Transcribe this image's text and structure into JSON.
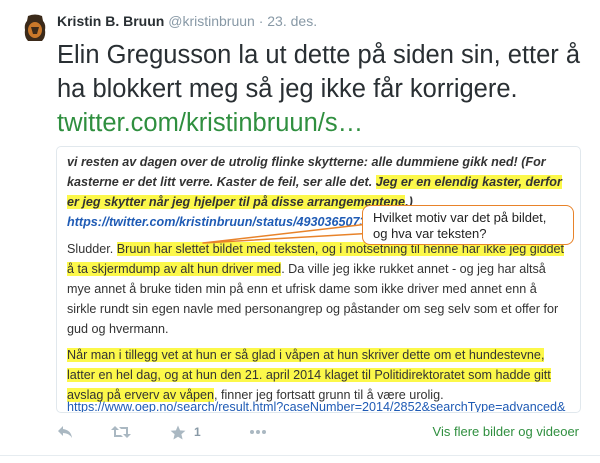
{
  "tweet": {
    "fullname": "Kristin B. Bruun",
    "username": "@kristinbruun",
    "separator": "·",
    "date": "23. des.",
    "text": "Elin Gregusson la ut dette på siden sin, etter å ha blokkert meg så jeg ikke får korrigere.",
    "link": "twitter.com/kristinbruun/s…"
  },
  "media": {
    "p1": {
      "a": "vi resten av dagen over de utrolig flinke skytterne: alle dummiene gikk ned! (For kasterne er det litt verre. Kaster de feil, ser alle det. ",
      "hl": "Jeg er en elendig kaster, derfor er jeg skytter når jeg hjelper til på disse arrangementene",
      "b": ".) ",
      "link": "https://twitter.com/kristinbruun/status/493036507377459200"
    },
    "p2": {
      "a": "Sludder. ",
      "hl": "Bruun har slettet bildet med teksten, og i motsetning til henne har ikke jeg giddet å ta skjermdump av alt hun driver med",
      "b": ". Da ville jeg ikke rukket annet - og jeg har altså mye annet å bruke tiden min på enn et ufrisk dame som ikke driver med annet enn å sirkle rundt sin egen navle med personangrep og påstander om seg selv som et offer for gud og hvermann."
    },
    "p3": {
      "hl": "Når man i tillegg vet at hun er så glad i våpen at hun skriver dette om et hundestevne, latter en hel dag, og at hun den 21. april 2014 klaget til Politidirektoratet som hadde gitt avslag på erverv av våpen",
      "b": ", finner jeg fortsatt grunn til å være urolig."
    },
    "cut_link": "https://www.oep.no/search/result.html?caseNumber=2014/2852&searchType=advanced&",
    "callout": "Hvilket motiv var det på bildet, og hva var teksten?"
  },
  "actions": {
    "favorite_count": "1",
    "more_media_label": "Vis flere bilder og videoer"
  },
  "colors": {
    "highlight": "#fcf84a",
    "callout_border": "#e8832a",
    "link_green": "#2f8f3f"
  },
  "icons": [
    "reply-icon",
    "retweet-icon",
    "favorite-star-icon",
    "more-options-icon"
  ]
}
